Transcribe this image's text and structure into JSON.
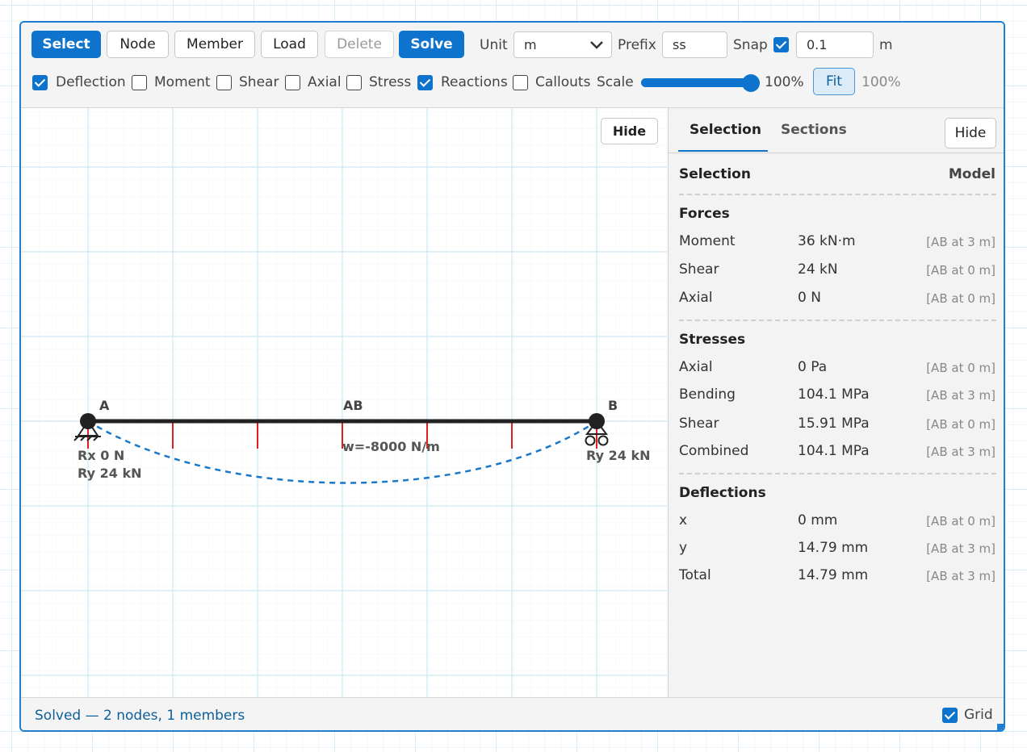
{
  "toolbar": {
    "buttons": {
      "select": "Select",
      "node": "Node",
      "member": "Member",
      "load": "Load",
      "delete": "Delete",
      "solve": "Solve"
    },
    "unit_label": "Unit",
    "unit_value": "m",
    "prefix_label": "Prefix",
    "prefix_value": "ss",
    "snap_label": "Snap",
    "snap_checked": true,
    "snap_value": "0.1",
    "snap_unit": "m",
    "toggles": [
      {
        "label": "Deflection",
        "checked": true
      },
      {
        "label": "Moment",
        "checked": false
      },
      {
        "label": "Shear",
        "checked": false
      },
      {
        "label": "Axial",
        "checked": false
      },
      {
        "label": "Stress",
        "checked": false
      },
      {
        "label": "Reactions",
        "checked": true
      },
      {
        "label": "Callouts",
        "checked": false
      }
    ],
    "scale_label": "Scale",
    "scale_value": "100%",
    "scale_level_fraction": 1.0,
    "fit_label": "Fit",
    "zoom_value": "100%"
  },
  "canvas": {
    "hide_label": "Hide",
    "nodes": {
      "a": "A",
      "b": "B"
    },
    "member_label": "AB",
    "load_label": "w=-8000 N/m",
    "reactions": {
      "a_rx": "Rx 0 N",
      "a_ry": "Ry 24 kN",
      "b_ry": "Ry 24 kN"
    },
    "colors": {
      "member": "#222222",
      "deflection": "#1877c9",
      "load": "#e02020"
    }
  },
  "panel": {
    "tabs": {
      "selection": "Selection",
      "sections": "Sections"
    },
    "active_tab": "Selection",
    "hide_label": "Hide",
    "header_title": "Selection",
    "header_scope": "Model",
    "forces": {
      "title": "Forces",
      "rows": [
        {
          "name": "Moment",
          "value": "36 kN·m",
          "loc": "[AB at 3 m]"
        },
        {
          "name": "Shear",
          "value": "24 kN",
          "loc": "[AB at 0 m]"
        },
        {
          "name": "Axial",
          "value": "0 N",
          "loc": "[AB at 0 m]"
        }
      ]
    },
    "stresses": {
      "title": "Stresses",
      "rows": [
        {
          "name": "Axial",
          "value": "0 Pa",
          "loc": "[AB at 0 m]"
        },
        {
          "name": "Bending",
          "value": "104.1 MPa",
          "loc": "[AB at 3 m]"
        },
        {
          "name": "Shear",
          "value": "15.91 MPa",
          "loc": "[AB at 0 m]"
        },
        {
          "name": "Combined",
          "value": "104.1 MPa",
          "loc": "[AB at 3 m]"
        }
      ]
    },
    "deflections": {
      "title": "Deflections",
      "rows": [
        {
          "name": "x",
          "value": "0 mm",
          "loc": "[AB at 0 m]"
        },
        {
          "name": "y",
          "value": "14.79 mm",
          "loc": "[AB at 3 m]"
        },
        {
          "name": "Total",
          "value": "14.79 mm",
          "loc": "[AB at 3 m]"
        }
      ]
    }
  },
  "status": {
    "text": "Solved — 2 nodes, 1 members",
    "grid_label": "Grid",
    "grid_checked": true
  }
}
